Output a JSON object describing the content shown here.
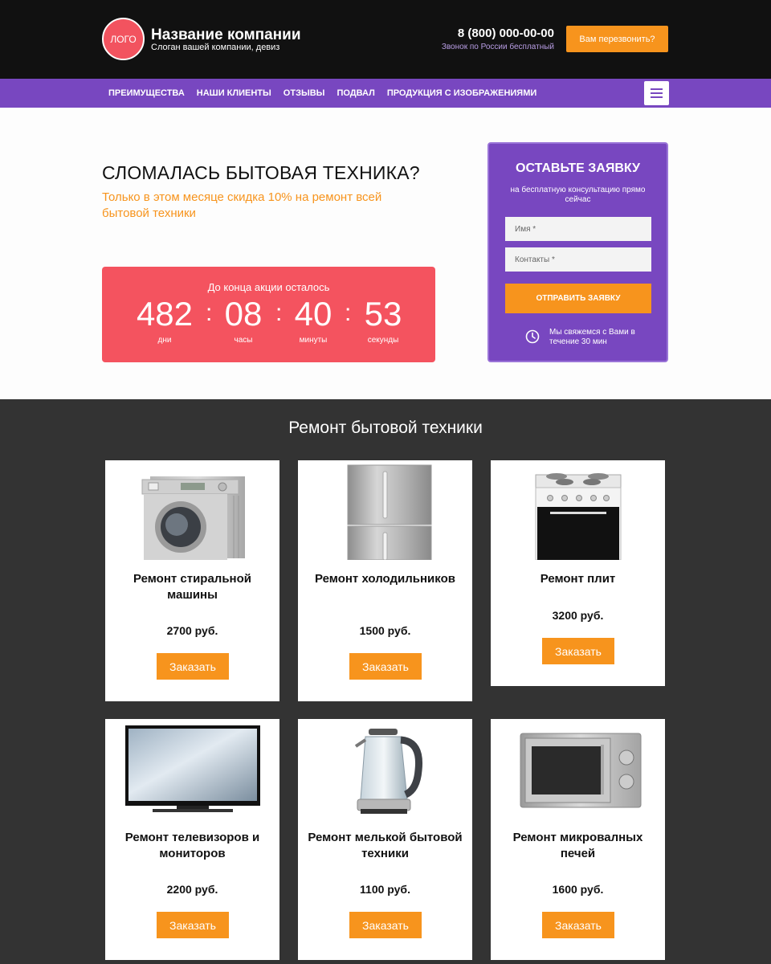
{
  "header": {
    "logo_text": "ЛОГО",
    "company_name": "Название компании",
    "slogan": "Слоган вашей компании, девиз",
    "phone": "8 (800) 000-00-00",
    "phone_note": "Звонок по России бесплатный",
    "callback_label": "Вам перезвонить?"
  },
  "nav": {
    "items": [
      {
        "label": "ПРЕИМУЩЕСТВА"
      },
      {
        "label": "НАШИ КЛИЕНТЫ"
      },
      {
        "label": "ОТЗЫВЫ"
      },
      {
        "label": "ПОДВАЛ"
      },
      {
        "label": "ПРОДУКЦИЯ С ИЗОБРАЖЕНИЯМИ"
      }
    ]
  },
  "hero": {
    "title": "СЛОМАЛАСЬ БЫТОВАЯ ТЕХНИКА?",
    "subtitle": "Только в этом месяце скидка 10% на ремонт всей бытовой техники",
    "timer": {
      "label": "До конца акции осталось",
      "days": "482",
      "days_label": "дни",
      "hours": "08",
      "hours_label": "часы",
      "minutes": "40",
      "minutes_label": "минуты",
      "seconds": "53",
      "seconds_label": "секунды",
      "separator": ":"
    }
  },
  "form": {
    "title": "ОСТАВЬТЕ ЗАЯВКУ",
    "subtitle": "на бесплатную консультацию прямо сейчас",
    "name_placeholder": "Имя *",
    "contacts_placeholder": "Контакты *",
    "submit_label": "ОТПРАВИТЬ ЗАЯВКУ",
    "note": "Мы свяжемся с Вами в течение 30 мин"
  },
  "products": {
    "title": "Ремонт бытовой техники",
    "order_label": "Заказать",
    "items": [
      {
        "name": "Ремонт стиральной машины",
        "price": "2700 руб.",
        "icon": "washing-machine"
      },
      {
        "name": "Ремонт холодильников",
        "price": "1500 руб.",
        "icon": "refrigerator"
      },
      {
        "name": "Ремонт плит",
        "price": "3200 руб.",
        "icon": "stove"
      },
      {
        "name": "Ремонт телевизоров и мониторов",
        "price": "2200 руб.",
        "icon": "tv-monitor"
      },
      {
        "name": "Ремонт мелькой бытовой техники",
        "price": "1100 руб.",
        "icon": "kettle"
      },
      {
        "name": "Ремонт микровалных печей",
        "price": "1600 руб.",
        "icon": "microwave"
      }
    ]
  },
  "colors": {
    "accent_orange": "#f7941d",
    "purple": "#7847c0",
    "timer_red": "#f4535f"
  }
}
